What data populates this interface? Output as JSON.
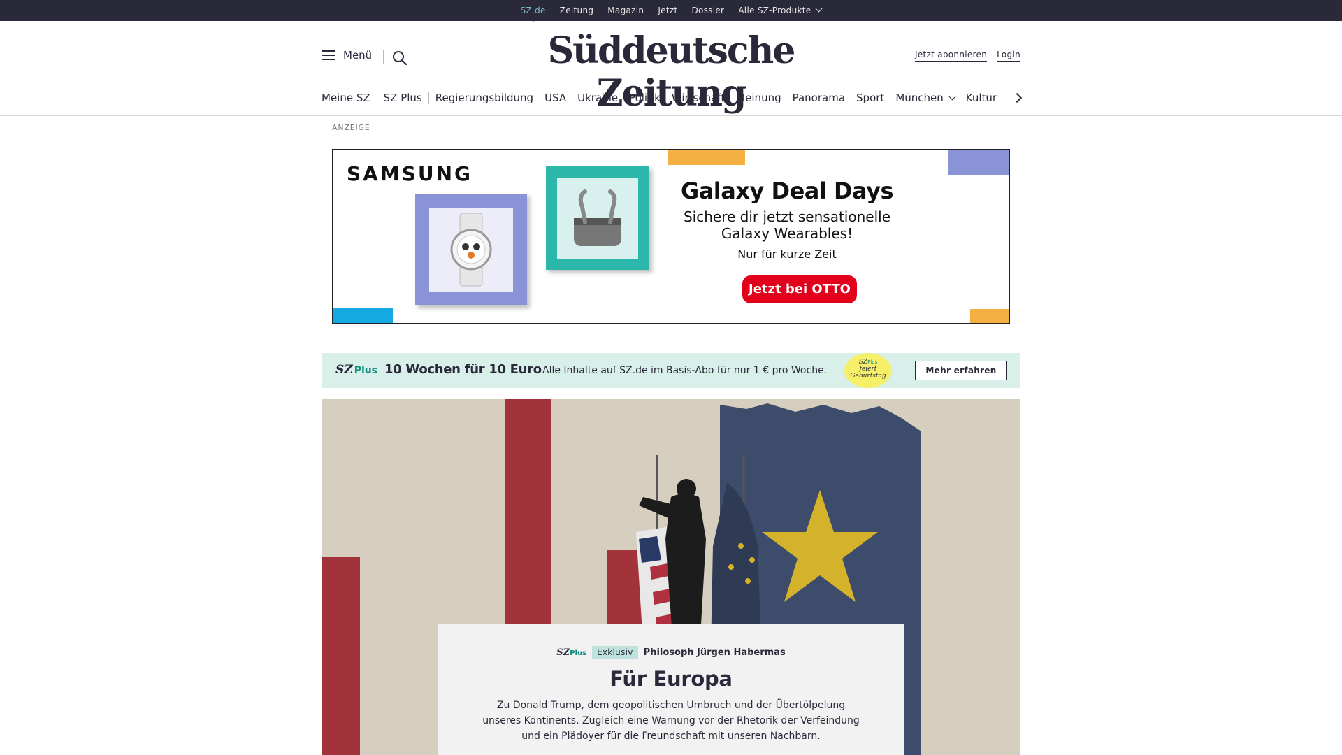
{
  "topbar": {
    "links": [
      "SZ.de",
      "Zeitung",
      "Magazin",
      "Jetzt",
      "Dossier"
    ],
    "products_label": "Alle SZ-Produkte"
  },
  "header": {
    "menu_label": "Menü",
    "logo": "Süddeutsche Zeitung",
    "subscribe_label": "Jetzt abonnieren",
    "login_label": "Login"
  },
  "nav": {
    "items": [
      "Meine SZ",
      "SZ Plus",
      "Regierungsbildung",
      "USA",
      "Ukraine",
      "Politik",
      "Wirtschaft",
      "Meinung",
      "Panorama",
      "Sport",
      "München",
      "Kultur"
    ]
  },
  "ad": {
    "label": "ANZEIGE",
    "brand": "SAMSUNG",
    "title": "Galaxy Deal Days",
    "subtitle": "Sichere dir jetzt sensationelle Galaxy Wearables!",
    "small": "Nur für kurze Zeit",
    "cta": "Jetzt bei OTTO"
  },
  "promo": {
    "logo_sz": "SZ",
    "logo_plus": "Plus",
    "headline": "10 Wochen für 10 Euro",
    "text": "Alle Inhalte auf SZ.de im Basis-Abo für nur 1 € pro Woche.",
    "badge_line1": "SZ",
    "badge_plus": "Plus",
    "badge_line2": "feiert",
    "badge_line3": "Geburtstag",
    "button": "Mehr erfahren"
  },
  "article": {
    "logo_sz": "SZ",
    "logo_plus": "Plus",
    "tag": "Exklusiv",
    "kicker": "Philosoph Jürgen Habermas",
    "title": "Für Europa",
    "teaser": "Zu Donald Trump, dem geopolitischen Umbruch und der Übertölpelung unseres Kontinents. Zugleich eine Warnung vor der Rhetorik der Verfeindung und ein Plädoyer für die Freundschaft mit unseren Nachbarn."
  },
  "colors": {
    "topbar": "#29293a",
    "accent_teal": "#7fb8c6",
    "promo_bg": "#d9efea",
    "hero_bg": "#d6cfc0",
    "hero_red": "#a2333a",
    "hero_blue": "#3d4c6a",
    "star_yellow": "#d5b22c",
    "otto_red": "#e3001b"
  }
}
